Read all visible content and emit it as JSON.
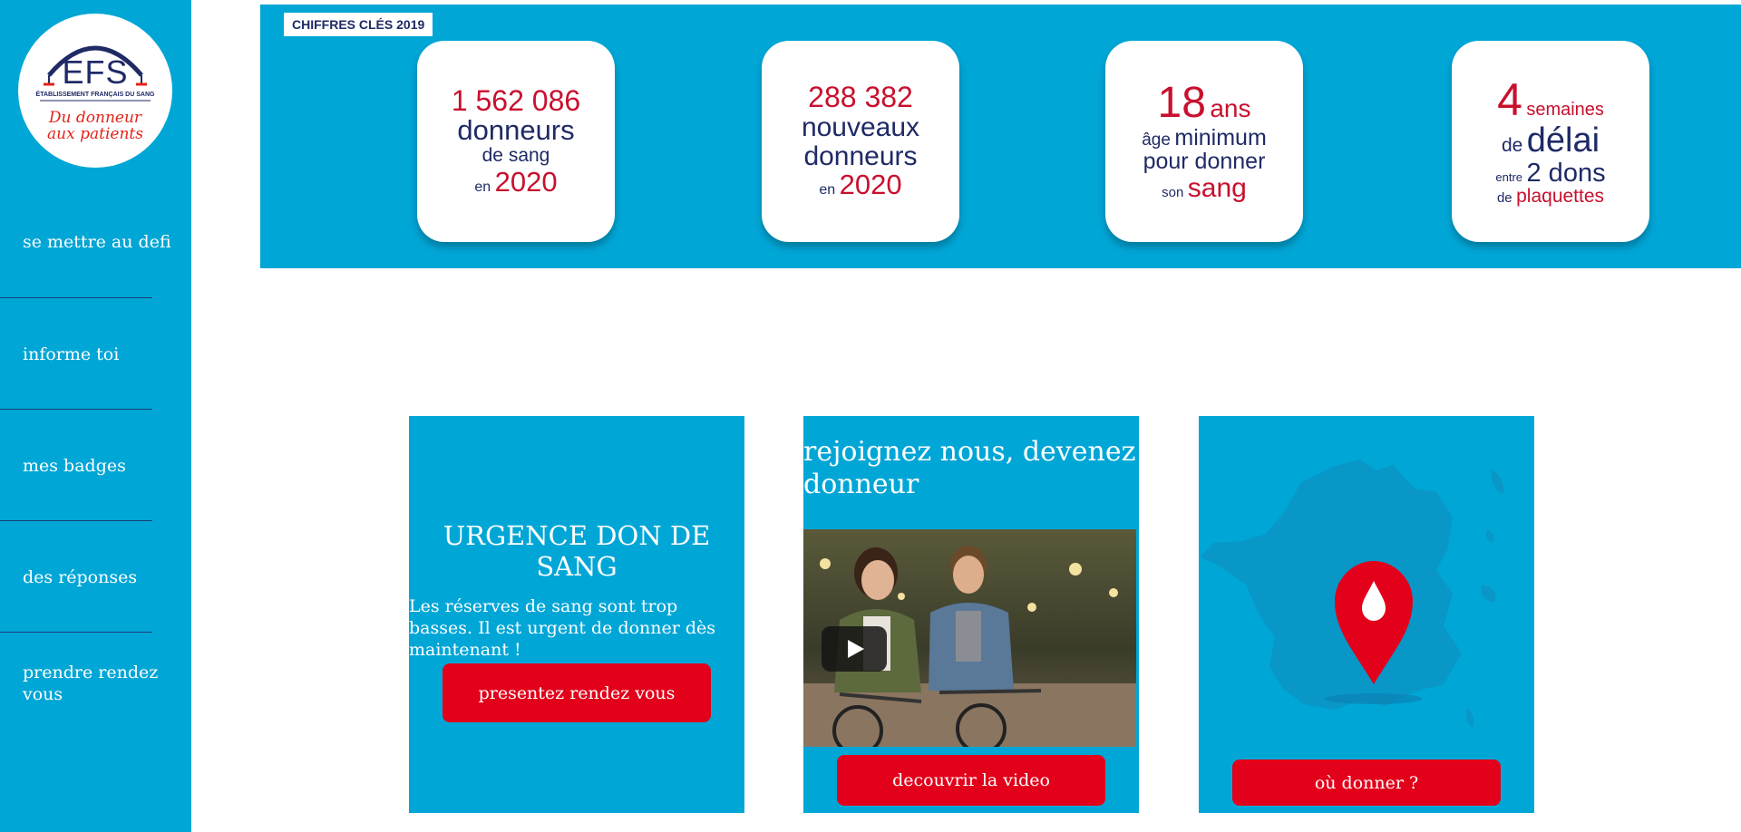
{
  "sidebar": {
    "logo": {
      "brand": "EFS",
      "subtitle": "ÉTABLISSEMENT FRANÇAIS DU SANG",
      "tagline_1": "Du donneur",
      "tagline_2": "aux patients"
    },
    "items": [
      {
        "label": "se mettre au defi"
      },
      {
        "label": "informe toi"
      },
      {
        "label": "mes badges"
      },
      {
        "label": "des réponses"
      },
      {
        "label": "prendre rendez vous"
      }
    ]
  },
  "banner": {
    "tag": "CHIFFRES CLÉS 2019",
    "cards": [
      {
        "l1": "1 562 086",
        "l2": "donneurs",
        "l3": "de sang",
        "l4a": "en",
        "l4b": "2020"
      },
      {
        "l1": "288 382",
        "l2": "nouveaux",
        "l3": "donneurs",
        "l4a": "en",
        "l4b": "2020"
      },
      {
        "l1a": "18",
        "l1b": "ans",
        "l2a": "âge",
        "l2b": "minimum",
        "l3": "pour donner",
        "l4a": "son",
        "l4b": "sang"
      },
      {
        "l1a": "4",
        "l1b": "semaines",
        "l2a": "de",
        "l2b": "délai",
        "l3a": "entre",
        "l3b": "2 dons",
        "l4a": "de",
        "l4b": "plaquettes"
      }
    ]
  },
  "cards": {
    "urgence": {
      "title": "URGENCE DON DE SANG",
      "text": "Les réserves de sang sont trop basses. Il est urgent de donner dès maintenant !",
      "button": "presentez rendez vous"
    },
    "video": {
      "title": "rejoignez nous, devenez donneur",
      "button": "decouvrir la video"
    },
    "map": {
      "button": "où donner ?"
    }
  },
  "colors": {
    "primary_blue": "#00a6d6",
    "brand_red": "#e2001a",
    "navy": "#1f2a66"
  }
}
